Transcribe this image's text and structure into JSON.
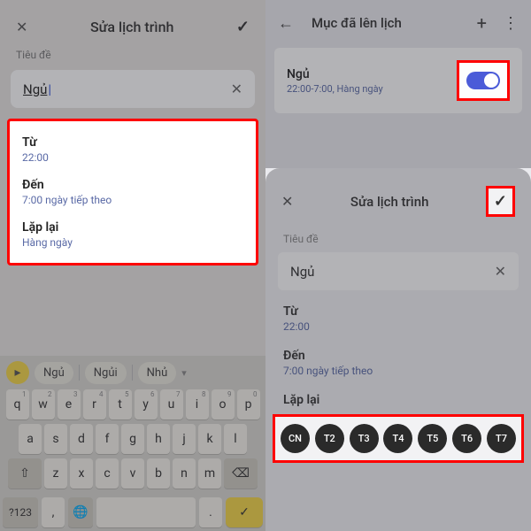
{
  "left": {
    "header_title": "Sửa lịch trình",
    "label_title": "Tiêu đề",
    "input_value": "Ngủ",
    "from_label": "Từ",
    "from_value": "22:00",
    "to_label": "Đến",
    "to_value": "7:00 ngày tiếp theo",
    "repeat_label": "Lặp lại",
    "repeat_value": "Hàng ngày",
    "suggest_1": "Ngủ",
    "suggest_2": "Ngủi",
    "suggest_3": "Nhủ",
    "num_key": "?123"
  },
  "right": {
    "top_title": "Mục đã lên lịch",
    "sched_name": "Ngủ",
    "sched_sub": "22:00-7:00, Hàng ngày",
    "sheet_title": "Sửa lịch trình",
    "label_title": "Tiêu đề",
    "input_value": "Ngủ",
    "from_label": "Từ",
    "from_value": "22:00",
    "to_label": "Đến",
    "to_value": "7:00 ngày tiếp theo",
    "repeat_label": "Lặp lại",
    "days": [
      "CN",
      "T2",
      "T3",
      "T4",
      "T5",
      "T6",
      "T7"
    ]
  },
  "kb": {
    "row1": [
      "q",
      "w",
      "e",
      "r",
      "t",
      "y",
      "u",
      "i",
      "o",
      "p"
    ],
    "sup1": [
      "1",
      "2",
      "3",
      "4",
      "5",
      "6",
      "7",
      "8",
      "9",
      "0"
    ],
    "row2": [
      "a",
      "s",
      "d",
      "f",
      "g",
      "h",
      "j",
      "k",
      "l"
    ],
    "row3": [
      "z",
      "x",
      "c",
      "v",
      "b",
      "n",
      "m"
    ]
  }
}
